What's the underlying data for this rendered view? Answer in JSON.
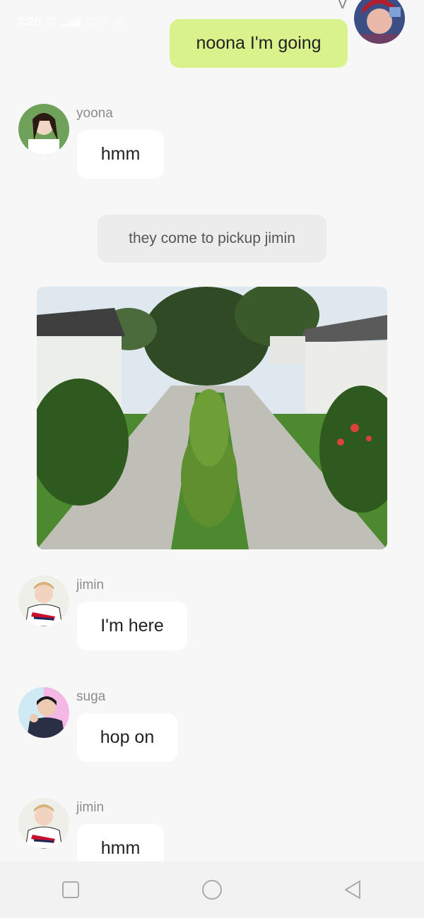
{
  "status_bar": {
    "time": "3:20",
    "network_label_top": "4G",
    "network_label_bottom": "HD",
    "speed_top": "0.41 KB",
    "speed_bottom": "KB/S",
    "signal_icon": "signal-icon",
    "alarm_icon": "alarm-icon"
  },
  "colors": {
    "outgoing_bubble": "#d9f28c",
    "incoming_bubble": "#ffffff",
    "system_pill": "#ececec",
    "background": "#f7f7f7",
    "sender_name": "#8c8c8c"
  },
  "messages": [
    {
      "type": "outgoing",
      "sender": "V",
      "text": "noona I'm going"
    },
    {
      "type": "incoming",
      "sender": "yoona",
      "text": "hmm"
    },
    {
      "type": "system",
      "text": "they come to pickup jimin"
    },
    {
      "type": "image",
      "description": ""
    },
    {
      "type": "incoming",
      "sender": "jimin",
      "text": "I'm here"
    },
    {
      "type": "incoming",
      "sender": "suga",
      "text": "hop on"
    },
    {
      "type": "incoming",
      "sender": "jimin",
      "text": "hmm"
    }
  ],
  "navbar": {
    "recents_icon": "square-icon",
    "home_icon": "circle-icon",
    "back_icon": "triangle-back-icon"
  }
}
